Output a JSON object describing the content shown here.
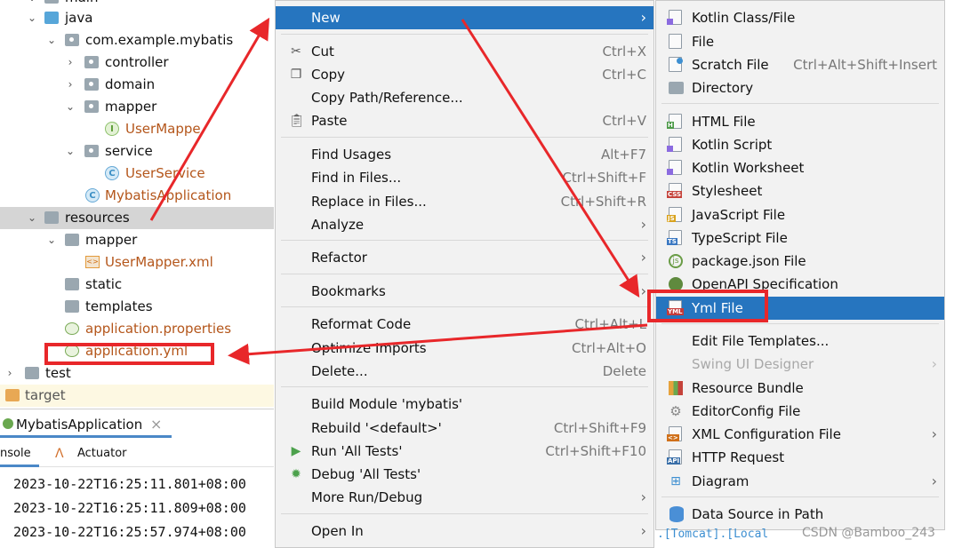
{
  "tree": {
    "main_label": "main",
    "java_label": "java",
    "package_label": "com.example.mybatis",
    "controller_label": "controller",
    "domain_label": "domain",
    "mapper_label": "mapper",
    "usermapper_label": "UserMappe",
    "service_label": "service",
    "userservice_label": "UserService",
    "mybatisapp_label": "MybatisApplication",
    "resources_label": "resources",
    "res_mapper_label": "mapper",
    "usermapper_xml_label": "UserMapper.xml",
    "static_label": "static",
    "templates_label": "templates",
    "app_props_label": "application.properties",
    "app_yml_label": "application.yml",
    "test_label": "test",
    "target_label": "target"
  },
  "run_panel": {
    "tab_label": "MybatisApplication",
    "close_glyph": "×",
    "console_tab": "nsole",
    "actuator_tab": "Actuator",
    "log_lines": [
      "2023-10-22T16:25:11.801+08:00",
      "2023-10-22T16:25:11.809+08:00",
      "2023-10-22T16:25:57.974+08:00"
    ]
  },
  "context_menu": {
    "new": {
      "label": "New"
    },
    "cut": {
      "label": "Cut",
      "shortcut": "Ctrl+X"
    },
    "copy": {
      "label": "Copy",
      "shortcut": "Ctrl+C"
    },
    "copy_path": {
      "label": "Copy Path/Reference..."
    },
    "paste": {
      "label": "Paste",
      "shortcut": "Ctrl+V"
    },
    "find_usages": {
      "label": "Find Usages",
      "shortcut": "Alt+F7"
    },
    "find_in_files": {
      "label": "Find in Files...",
      "shortcut": "Ctrl+Shift+F"
    },
    "replace_in_files": {
      "label": "Replace in Files...",
      "shortcut": "Ctrl+Shift+R"
    },
    "analyze": {
      "label": "Analyze"
    },
    "refactor": {
      "label": "Refactor"
    },
    "bookmarks": {
      "label": "Bookmarks"
    },
    "reformat": {
      "label": "Reformat Code",
      "shortcut": "Ctrl+Alt+L"
    },
    "optimize": {
      "label": "Optimize Imports",
      "shortcut": "Ctrl+Alt+O"
    },
    "delete": {
      "label": "Delete...",
      "shortcut": "Delete"
    },
    "build_module": {
      "label": "Build Module 'mybatis'"
    },
    "rebuild": {
      "label": "Rebuild '<default>'",
      "shortcut": "Ctrl+Shift+F9"
    },
    "run_tests": {
      "label": "Run 'All Tests'",
      "shortcut": "Ctrl+Shift+F10"
    },
    "debug_tests": {
      "label": "Debug 'All Tests'"
    },
    "more_run": {
      "label": "More Run/Debug"
    },
    "open_in": {
      "label": "Open In"
    }
  },
  "new_submenu": {
    "kotlin_class": {
      "label": "Kotlin Class/File"
    },
    "file": {
      "label": "File"
    },
    "scratch": {
      "label": "Scratch File",
      "shortcut": "Ctrl+Alt+Shift+Insert"
    },
    "directory": {
      "label": "Directory"
    },
    "html": {
      "label": "HTML File"
    },
    "kotlin_script": {
      "label": "Kotlin Script"
    },
    "kotlin_worksheet": {
      "label": "Kotlin Worksheet"
    },
    "stylesheet": {
      "label": "Stylesheet"
    },
    "javascript": {
      "label": "JavaScript File"
    },
    "typescript": {
      "label": "TypeScript File"
    },
    "package_json": {
      "label": "package.json File"
    },
    "openapi": {
      "label": "OpenAPI Specification"
    },
    "yml": {
      "label": "Yml File"
    },
    "edit_templates": {
      "label": "Edit File Templates..."
    },
    "swing": {
      "label": "Swing UI Designer"
    },
    "resource_bundle": {
      "label": "Resource Bundle"
    },
    "editorconfig": {
      "label": "EditorConfig File"
    },
    "xml_config": {
      "label": "XML Configuration File"
    },
    "http_request": {
      "label": "HTTP Request"
    },
    "diagram": {
      "label": "Diagram"
    },
    "data_source": {
      "label": "Data Source in Path"
    }
  },
  "icons": {
    "tag_html": "H",
    "tag_css": "CSS",
    "tag_js": "JS",
    "tag_ts": "TS",
    "tag_yml": "YML",
    "tag_api": "API",
    "tag_xml": "<>",
    "tag_xml_tree": "<>",
    "class_c": "C",
    "interface_i": "I"
  },
  "overlay": {
    "watermark": "CSDN @Bamboo_243",
    "right_snippet": ".[Tomcat].[Local"
  },
  "colors": {
    "selection": "#2675bf",
    "annotation_red": "#e8272a",
    "tree_selected": "#d5d5d5",
    "menu_bg": "#f2f2f2",
    "file_orange": "#b4561b"
  }
}
